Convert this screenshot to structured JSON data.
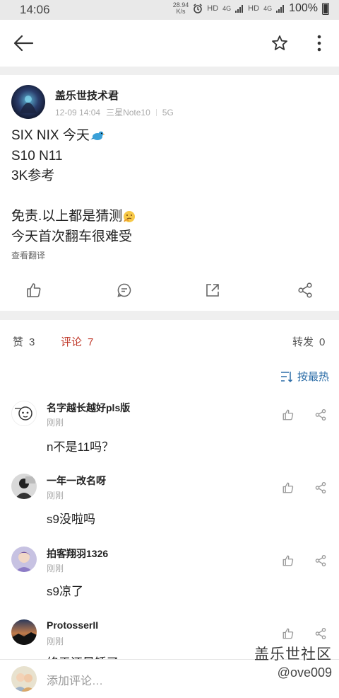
{
  "status_bar": {
    "time": "14:06",
    "net_speed_value": "28.94",
    "net_speed_unit": "K/s",
    "hd1": "HD",
    "lte1": "4G",
    "hd2": "HD",
    "lte2": "4G",
    "battery": "100%"
  },
  "colors": {
    "accent": "#c0392b",
    "link": "#2f6fa8",
    "divider": "#efefef"
  },
  "post": {
    "author": "盖乐世技术君",
    "date": "12-09 14:04",
    "device": "三星Note10",
    "network": "5G",
    "lines": [
      "SIX NIX 今天",
      "S10 N11",
      "3K参考",
      "",
      "免责.以上都是猜测",
      "今天首次翻车很难受"
    ],
    "translate_label": "查看翻译"
  },
  "tabs": {
    "likes_label": "赞",
    "likes_count": "3",
    "comments_label": "评论",
    "comments_count": "7",
    "reposts_label": "转发",
    "reposts_count": "0"
  },
  "sort_label": "按最热",
  "comments": [
    {
      "name": "名字越长越好pls版",
      "time": "刚刚",
      "text": "n不是11吗？"
    },
    {
      "name": "一年一改名呀",
      "time": "刚刚",
      "text": "s9没啦吗"
    },
    {
      "name": "拍客翔羽1326",
      "time": "刚刚",
      "text": "s9凉了"
    },
    {
      "name": "ProtosserII",
      "time": "刚刚",
      "text": "终于还是锤了"
    }
  ],
  "composer": {
    "placeholder": "添加评论…"
  },
  "watermark": {
    "line1": "盖乐世社区",
    "line2": "@ove009"
  }
}
